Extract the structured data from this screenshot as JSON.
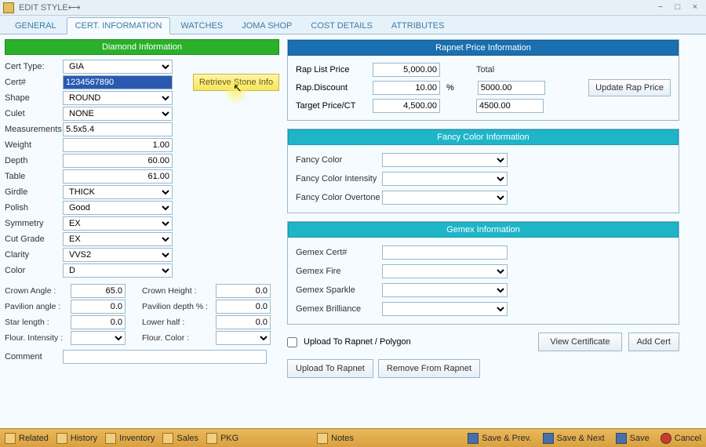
{
  "window": {
    "title": "EDIT STYLE"
  },
  "tabs": {
    "general": "GENERAL",
    "cert": "CERT. INFORMATION",
    "watches": "WATCHES",
    "joma": "JOMA SHOP",
    "cost": "COST DETAILS",
    "attributes": "ATTRIBUTES"
  },
  "diamond": {
    "header": "Diamond Information",
    "labels": {
      "cert_type": "Cert Type:",
      "cert_no": "Cert#",
      "shape": "Shape",
      "culet": "Culet",
      "measurements": "Measurements",
      "weight": "Weight",
      "depth": "Depth",
      "table": "Table",
      "girdle": "Girdle",
      "polish": "Polish",
      "symmetry": "Symmetry",
      "cut_grade": "Cut Grade",
      "clarity": "Clarity",
      "color": "Color",
      "crown_angle": "Crown Angle :",
      "pavilion_angle": "Pavilion angle :",
      "star_length": "Star length :",
      "flour_intensity": "Flour. Intensity :",
      "crown_height": "Crown Height :",
      "pavilion_depth": "Pavilion depth % :",
      "lower_half": "Lower half :",
      "flour_color": "Flour. Color :",
      "comment": "Comment"
    },
    "values": {
      "cert_type": "GIA",
      "cert_no": "1234567890",
      "shape": "ROUND",
      "culet": "NONE",
      "measurements": "5.5x5.4",
      "weight": "1.00",
      "depth": "60.00",
      "table": "61.00",
      "girdle": "THICK",
      "polish": "Good",
      "symmetry": "EX",
      "cut_grade": "EX",
      "clarity": "VVS2",
      "color": "D",
      "crown_angle": "65.0",
      "pavilion_angle": "0.0",
      "star_length": "0.0",
      "flour_intensity": "",
      "crown_height": "0.0",
      "pavilion_depth": "0.0",
      "lower_half": "0.0",
      "flour_color": "",
      "comment": ""
    },
    "retrieve_btn": "Retrieve Stone Info"
  },
  "rapnet": {
    "header": "Rapnet Price Information",
    "labels": {
      "rap_list": "Rap List Price",
      "rap_discount": "Rap.Discount",
      "target_price": "Target Price/CT",
      "total": "Total",
      "pct": "%"
    },
    "values": {
      "rap_list": "5,000.00",
      "rap_discount": "10.00",
      "target_price": "4,500.00",
      "total": "5000.00",
      "target_total": "4500.00"
    },
    "update_btn": "Update Rap Price"
  },
  "fancy": {
    "header": "Fancy Color Information",
    "labels": {
      "color": "Fancy Color",
      "intensity": "Fancy Color Intensity",
      "overtone": "Fancy Color Overtone"
    }
  },
  "gemex": {
    "header": "Gemex Information",
    "labels": {
      "cert": "Gemex Cert#",
      "fire": "Gemex Fire",
      "sparkle": "Gemex Sparkle",
      "brilliance": "Gemex Brilliance"
    }
  },
  "actions": {
    "upload_chk": "Upload To Rapnet / Polygon",
    "view_cert": "View Certificate",
    "add_cert": "Add Cert",
    "upload_rapnet": "Upload To Rapnet",
    "remove_rapnet": "Remove From Rapnet"
  },
  "bottombar": {
    "related": "Related",
    "history": "History",
    "inventory": "Inventory",
    "sales": "Sales",
    "pkg": "PKG",
    "notes": "Notes",
    "save_prev": "Save & Prev.",
    "save_next": "Save & Next",
    "save": "Save",
    "cancel": "Cancel"
  }
}
